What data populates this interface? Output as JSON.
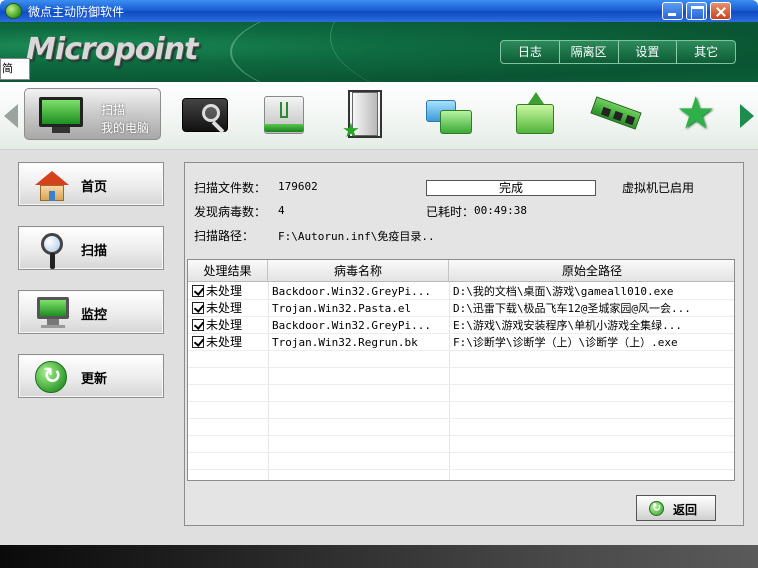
{
  "window": {
    "title": "微点主动防御软件",
    "controls": [
      "minimize",
      "maximize",
      "close"
    ]
  },
  "header": {
    "logo_text": "Micropoint",
    "menu": [
      {
        "label": "日志"
      },
      {
        "label": "隔离区"
      },
      {
        "label": "设置"
      },
      {
        "label": "其它"
      }
    ],
    "stray_tab_label": "简"
  },
  "toolbar": {
    "active_tool": {
      "label_line1": "扫描",
      "label_line2": "我的电脑",
      "icon": "computer-icon"
    },
    "tools": [
      {
        "icon": "disk-scan-icon"
      },
      {
        "icon": "usb-drive-icon"
      },
      {
        "icon": "door-star-icon"
      },
      {
        "icon": "folders-icon"
      },
      {
        "icon": "folder-upload-icon"
      },
      {
        "icon": "memory-module-icon"
      },
      {
        "icon": "star-icon"
      }
    ]
  },
  "sidebar": {
    "items": [
      {
        "label": "首页",
        "icon": "home-icon"
      },
      {
        "label": "扫描",
        "icon": "magnifier-icon"
      },
      {
        "label": "监控",
        "icon": "monitor-icon"
      },
      {
        "label": "更新",
        "icon": "refresh-icon"
      }
    ]
  },
  "scan": {
    "files_label": "扫描文件数：",
    "files_value": "179602",
    "status_text": "完成",
    "vm_status": "虚拟机已启用",
    "virus_label": "发现病毒数：",
    "virus_value": "4",
    "elapsed_label": "已耗时：",
    "elapsed_value": "00:49:38",
    "path_label": "扫描路径：",
    "path_value": "F:\\Autorun.inf\\免疫目录.."
  },
  "results": {
    "columns": [
      "处理结果",
      "病毒名称",
      "原始全路径"
    ],
    "rows": [
      {
        "checked": true,
        "result": "未处理",
        "name": "Backdoor.Win32.GreyPi...",
        "path": "D:\\我的文档\\桌面\\游戏\\gameall010.exe"
      },
      {
        "checked": true,
        "result": "未处理",
        "name": "Trojan.Win32.Pasta.el",
        "path": "D:\\迅雷下载\\极品飞车12@圣城家园@风一会..."
      },
      {
        "checked": true,
        "result": "未处理",
        "name": "Backdoor.Win32.GreyPi...",
        "path": "E:\\游戏\\游戏安装程序\\单机小游戏全集绿..."
      },
      {
        "checked": true,
        "result": "未处理",
        "name": "Trojan.Win32.Regrun.bk",
        "path": "F:\\诊断学\\诊断学（上）\\诊断学（上）.exe"
      }
    ]
  },
  "actions": {
    "back_label": "返回"
  },
  "colors": {
    "brand_green": "#0e6a40",
    "title_blue": "#1a5ed3"
  }
}
